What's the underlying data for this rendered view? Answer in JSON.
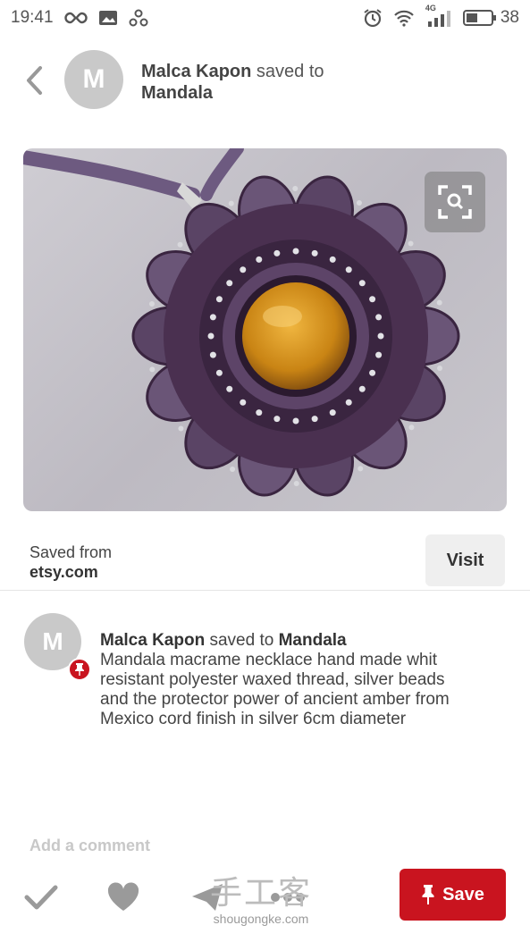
{
  "status_bar": {
    "time": "19:41",
    "network": "4G",
    "battery": "38"
  },
  "header": {
    "avatar_letter": "M",
    "user": "Malca Kapon",
    "saved_to_text": "saved to",
    "board": "Mandala"
  },
  "source": {
    "saved_from_label": "Saved from",
    "domain": "etsy.com",
    "visit_label": "Visit"
  },
  "activity": {
    "avatar_letter": "M",
    "user": "Malca Kapon",
    "saved_to_text": "saved to",
    "board": "Mandala",
    "description": "Mandala macrame necklace hand made whit resistant polyester waxed thread, silver beads and the protector power of ancient amber from Mexico cord finish in silver 6cm diameter"
  },
  "comment": {
    "placeholder": "Add a comment"
  },
  "bottom_bar": {
    "save_label": "Save"
  },
  "watermark": {
    "title": "手工客",
    "url": "shougongke.com"
  },
  "colors": {
    "save_red": "#c9141f",
    "avatar_gray": "#c9c9c9",
    "text_dark": "#333333"
  },
  "icons": [
    "infinity-icon",
    "image-icon",
    "share-node-icon",
    "alarm-icon",
    "wifi-icon",
    "signal-icon",
    "battery-icon",
    "back-chevron-icon",
    "visual-search-icon",
    "pin-icon",
    "check-icon",
    "heart-icon",
    "send-icon",
    "more-icon"
  ]
}
